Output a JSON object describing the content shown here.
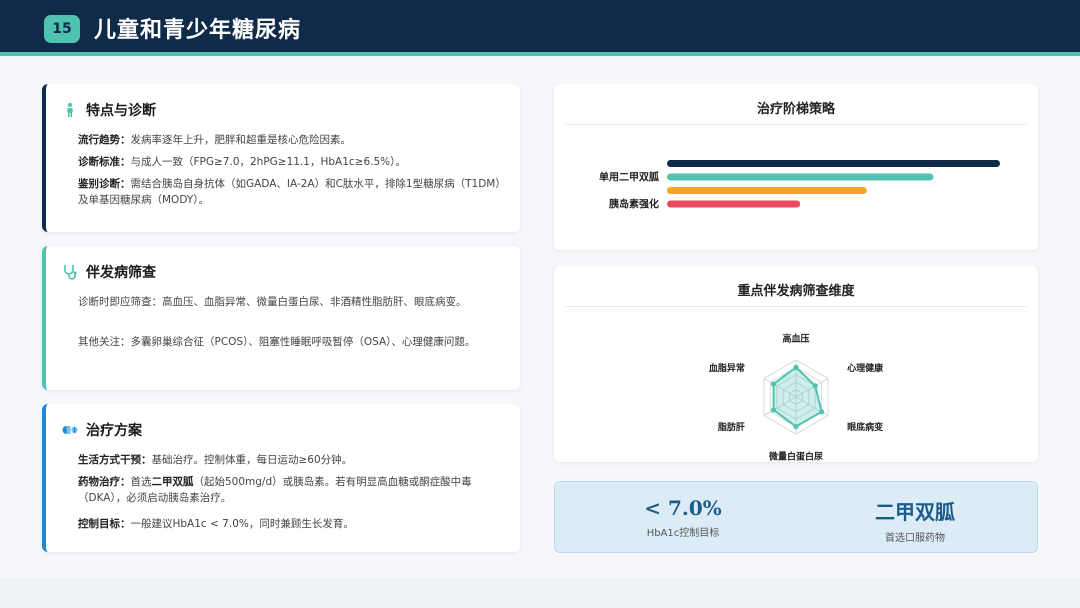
{
  "header": {
    "slide_number": "15",
    "title": "儿童和青少年糖尿病"
  },
  "cards": {
    "features": {
      "title": "特点与诊断",
      "icon": "person-icon",
      "lines": [
        {
          "label": "流行趋势：",
          "text": "发病率逐年上升，肥胖和超重是核心危险因素。"
        },
        {
          "label": "诊断标准：",
          "text": "与成人一致（FPG≥7.0，2hPG≥11.1，HbA1c≥6.5%）。"
        },
        {
          "label": "鉴别诊断：",
          "text": "需结合胰岛自身抗体（如GADA、IA-2A）和C肽水平，排除1型糖尿病（T1DM）及单基因糖尿病（MODY）。"
        }
      ]
    },
    "screening": {
      "title": "伴发病筛查",
      "icon": "stethoscope-icon",
      "lines": [
        {
          "text": "诊断时即应筛查：高血压、血脂异常、微量白蛋白尿、非酒精性脂肪肝、眼底病变。"
        },
        {
          "text": "其他关注：多囊卵巢综合征（PCOS）、阻塞性睡眠呼吸暂停（OSA）、心理健康问题。"
        }
      ]
    },
    "treatment": {
      "title": "治疗方案",
      "icon": "pill-icon",
      "lines": [
        {
          "label": "生活方式干预：",
          "text": "基础治疗。控制体重，每日运动≥60分钟。"
        },
        {
          "label": "药物治疗：",
          "text_pre": "首选",
          "text_bold": "二甲双胍",
          "text_post": "（起始500mg/d）或胰岛素。若有明显高血糖或酮症酸中毒（DKA），必须启动胰岛素治疗。"
        },
        {
          "label": "控制目标：",
          "text": "一般建议HbA1c < 7.0%，同时兼顾生长发育。"
        }
      ]
    }
  },
  "chart_data": [
    {
      "type": "bar",
      "title": "治疗阶梯策略",
      "orientation": "horizontal",
      "categories": [
        "",
        "单用二甲双胍",
        "",
        "胰岛素强化"
      ],
      "values": [
        100,
        80,
        60,
        40
      ],
      "colors": [
        "#102a4a",
        "#4fc3b0",
        "#f5a623",
        "#e84a5f"
      ],
      "xlim": [
        0,
        100
      ]
    },
    {
      "type": "radar",
      "title": "重点伴发病筛查维度",
      "axes": [
        "高血压",
        "心理健康",
        "眼底病变",
        "微量白蛋白尿",
        "脂肪肝",
        "血脂异常"
      ],
      "values": [
        80,
        60,
        80,
        80,
        70,
        70
      ],
      "range": [
        0,
        100
      ],
      "color": "#4fc3b0"
    }
  ],
  "stats": [
    {
      "value": "< 7.0%",
      "label": "HbA1c控制目标"
    },
    {
      "value": "二甲双胍",
      "label": "首选口服药物"
    }
  ]
}
